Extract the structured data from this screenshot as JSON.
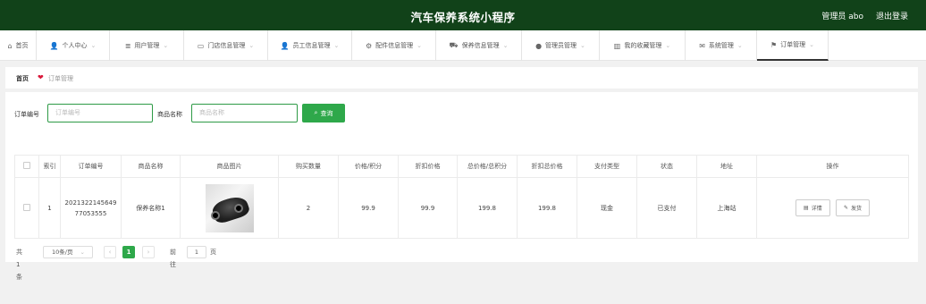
{
  "header": {
    "title": "汽车保养系统小程序",
    "admin_label": "管理员 abo",
    "logout_label": "退出登录",
    "bg_color": "#114219"
  },
  "nav": {
    "items": [
      {
        "label": "首页",
        "icon": "home-icon",
        "has_dropdown": false
      },
      {
        "label": "个人中心",
        "icon": "user-icon",
        "has_dropdown": true
      },
      {
        "label": "用户管理",
        "icon": "list-icon",
        "has_dropdown": true
      },
      {
        "label": "门店信息管理",
        "icon": "card-icon",
        "has_dropdown": true
      },
      {
        "label": "员工信息管理",
        "icon": "person-icon",
        "has_dropdown": true
      },
      {
        "label": "配件信息管理",
        "icon": "wrench-icon",
        "has_dropdown": true
      },
      {
        "label": "保养信息管理",
        "icon": "car-icon",
        "has_dropdown": true
      },
      {
        "label": "管理员管理",
        "icon": "location-icon",
        "has_dropdown": true
      },
      {
        "label": "我的收藏管理",
        "icon": "bar-chart-icon",
        "has_dropdown": true
      },
      {
        "label": "系统管理",
        "icon": "mail-icon",
        "has_dropdown": true
      },
      {
        "label": "订单管理",
        "icon": "flag-icon",
        "has_dropdown": true,
        "active": true
      }
    ]
  },
  "breadcrumb": {
    "home": "首页",
    "current": "订单管理"
  },
  "search": {
    "order_label": "订单编号",
    "order_placeholder": "订单编号",
    "product_label": "商品名称",
    "product_placeholder": "商品名称",
    "button_label": "查询",
    "accent_color": "#2ea84a"
  },
  "table": {
    "headers": [
      "",
      "索引",
      "订单编号",
      "商品名称",
      "商品图片",
      "购买数量",
      "价格/积分",
      "折扣价格",
      "总价格/总积分",
      "折扣总价格",
      "支付类型",
      "状态",
      "地址",
      "操作"
    ],
    "rows": [
      {
        "index": "1",
        "order_no": "202132214564977053555",
        "product_name": "保养名称1",
        "image": "black-car-image",
        "quantity": "2",
        "price": "99.9",
        "discount_price": "99.9",
        "total": "199.8",
        "discount_total": "199.8",
        "pay_type": "现金",
        "status": "已支付",
        "address": "上海站",
        "actions": {
          "detail": "详情",
          "ship": "发货"
        }
      }
    ]
  },
  "pagination": {
    "total_text": "共 1 条",
    "page_size": "10条/页",
    "current_page": "1",
    "goto_label": "前往",
    "goto_value": "1",
    "page_unit": "页"
  }
}
